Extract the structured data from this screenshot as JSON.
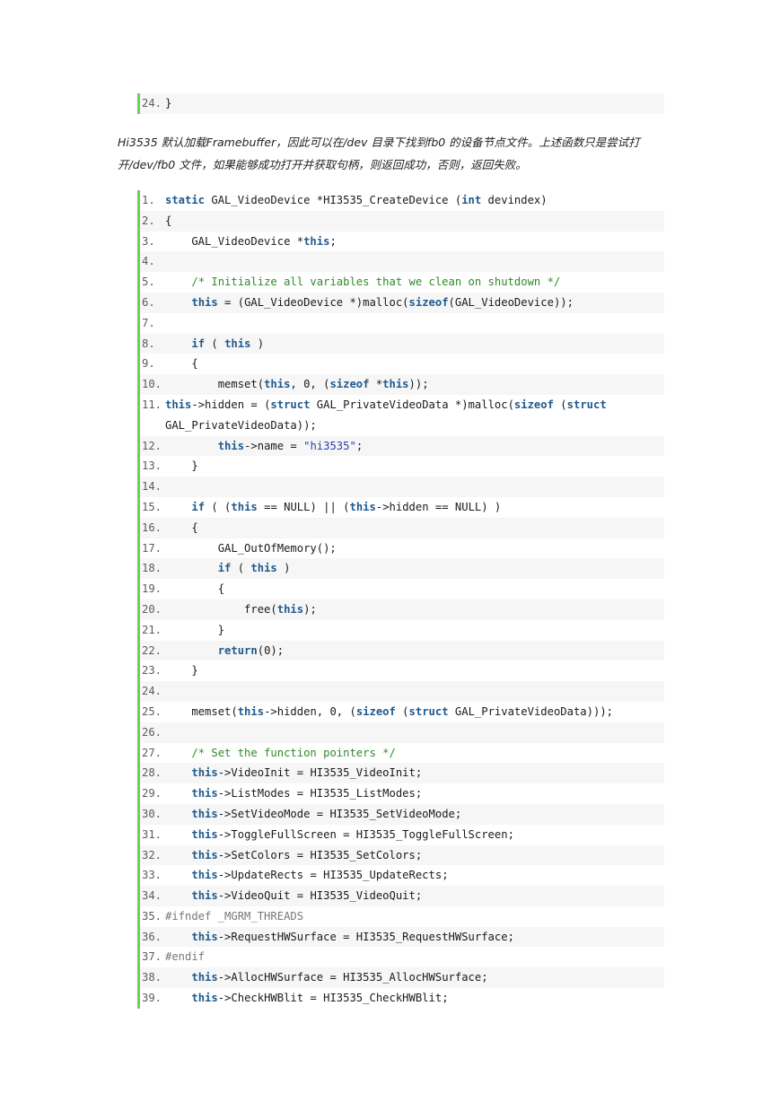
{
  "top_snippet": {
    "lines": [
      {
        "num": "24.",
        "segments": [
          {
            "t": "}",
            "c": ""
          }
        ]
      }
    ]
  },
  "paragraph": "Hi3535 默认加载Framebuffer，因此可以在/dev 目录下找到fb0 的设备节点文件。上述函数只是尝试打开/dev/fb0 文件，如果能够成功打开并获取句柄，则返回成功，否则，返回失败。",
  "code": {
    "lines": [
      {
        "num": "1.",
        "segments": [
          {
            "t": "static",
            "c": "kw"
          },
          {
            "t": " GAL_VideoDevice *HI3535_CreateDevice (",
            "c": ""
          },
          {
            "t": "int",
            "c": "kw"
          },
          {
            "t": " devindex)",
            "c": ""
          }
        ]
      },
      {
        "num": "2.",
        "segments": [
          {
            "t": "{",
            "c": ""
          }
        ]
      },
      {
        "num": "3.",
        "segments": [
          {
            "t": "    GAL_VideoDevice *",
            "c": ""
          },
          {
            "t": "this",
            "c": "kw"
          },
          {
            "t": ";",
            "c": ""
          }
        ]
      },
      {
        "num": "4.",
        "segments": []
      },
      {
        "num": "5.",
        "segments": [
          {
            "t": "    ",
            "c": ""
          },
          {
            "t": "/* Initialize all variables that we clean on shutdown */",
            "c": "cm"
          }
        ]
      },
      {
        "num": "6.",
        "segments": [
          {
            "t": "    ",
            "c": ""
          },
          {
            "t": "this",
            "c": "kw"
          },
          {
            "t": " = (GAL_VideoDevice *)malloc(",
            "c": ""
          },
          {
            "t": "sizeof",
            "c": "kw"
          },
          {
            "t": "(GAL_VideoDevice));",
            "c": ""
          }
        ]
      },
      {
        "num": "7.",
        "segments": []
      },
      {
        "num": "8.",
        "segments": [
          {
            "t": "    ",
            "c": ""
          },
          {
            "t": "if",
            "c": "kw"
          },
          {
            "t": " ( ",
            "c": ""
          },
          {
            "t": "this",
            "c": "kw"
          },
          {
            "t": " )",
            "c": ""
          }
        ]
      },
      {
        "num": "9.",
        "segments": [
          {
            "t": "    {",
            "c": ""
          }
        ]
      },
      {
        "num": "10.",
        "segments": [
          {
            "t": "        memset(",
            "c": ""
          },
          {
            "t": "this",
            "c": "kw"
          },
          {
            "t": ", 0, (",
            "c": ""
          },
          {
            "t": "sizeof",
            "c": "kw"
          },
          {
            "t": " *",
            "c": ""
          },
          {
            "t": "this",
            "c": "kw"
          },
          {
            "t": "));",
            "c": ""
          }
        ]
      },
      {
        "num": "11.",
        "tall": true,
        "segments": [
          {
            "t": "        ",
            "c": ""
          },
          {
            "t": "this",
            "c": "kw"
          },
          {
            "t": "->hidden = (",
            "c": ""
          },
          {
            "t": "struct",
            "c": "kw"
          },
          {
            "t": " GAL_PrivateVideoData *)malloc(",
            "c": ""
          },
          {
            "t": "sizeof",
            "c": "kw"
          },
          {
            "t": " (",
            "c": ""
          },
          {
            "t": "struct",
            "c": "kw"
          },
          {
            "t": " GAL_PrivateVideoData));",
            "c": ""
          }
        ]
      },
      {
        "num": "12.",
        "segments": [
          {
            "t": "        ",
            "c": ""
          },
          {
            "t": "this",
            "c": "kw"
          },
          {
            "t": "->name = ",
            "c": ""
          },
          {
            "t": "\"hi3535\"",
            "c": "st"
          },
          {
            "t": ";",
            "c": ""
          }
        ]
      },
      {
        "num": "13.",
        "segments": [
          {
            "t": "    }",
            "c": ""
          }
        ]
      },
      {
        "num": "14.",
        "segments": []
      },
      {
        "num": "15.",
        "segments": [
          {
            "t": "    ",
            "c": ""
          },
          {
            "t": "if",
            "c": "kw"
          },
          {
            "t": " ( (",
            "c": ""
          },
          {
            "t": "this",
            "c": "kw"
          },
          {
            "t": " == NULL) || (",
            "c": ""
          },
          {
            "t": "this",
            "c": "kw"
          },
          {
            "t": "->hidden == NULL) )",
            "c": ""
          }
        ]
      },
      {
        "num": "16.",
        "segments": [
          {
            "t": "    {",
            "c": ""
          }
        ]
      },
      {
        "num": "17.",
        "segments": [
          {
            "t": "        GAL_OutOfMemory();",
            "c": ""
          }
        ]
      },
      {
        "num": "18.",
        "segments": [
          {
            "t": "        ",
            "c": ""
          },
          {
            "t": "if",
            "c": "kw"
          },
          {
            "t": " ( ",
            "c": ""
          },
          {
            "t": "this",
            "c": "kw"
          },
          {
            "t": " )",
            "c": ""
          }
        ]
      },
      {
        "num": "19.",
        "segments": [
          {
            "t": "        {",
            "c": ""
          }
        ]
      },
      {
        "num": "20.",
        "segments": [
          {
            "t": "            free(",
            "c": ""
          },
          {
            "t": "this",
            "c": "kw"
          },
          {
            "t": ");",
            "c": ""
          }
        ]
      },
      {
        "num": "21.",
        "segments": [
          {
            "t": "        }",
            "c": ""
          }
        ]
      },
      {
        "num": "22.",
        "segments": [
          {
            "t": "        ",
            "c": ""
          },
          {
            "t": "return",
            "c": "kw"
          },
          {
            "t": "(0);",
            "c": ""
          }
        ]
      },
      {
        "num": "23.",
        "segments": [
          {
            "t": "    }",
            "c": ""
          }
        ]
      },
      {
        "num": "24.",
        "segments": []
      },
      {
        "num": "25.",
        "segments": [
          {
            "t": "    memset(",
            "c": ""
          },
          {
            "t": "this",
            "c": "kw"
          },
          {
            "t": "->hidden, 0, (",
            "c": ""
          },
          {
            "t": "sizeof",
            "c": "kw"
          },
          {
            "t": " (",
            "c": ""
          },
          {
            "t": "struct",
            "c": "kw"
          },
          {
            "t": " GAL_PrivateVideoData)));",
            "c": ""
          }
        ]
      },
      {
        "num": "26.",
        "segments": []
      },
      {
        "num": "27.",
        "segments": [
          {
            "t": "    ",
            "c": ""
          },
          {
            "t": "/* Set the function pointers */",
            "c": "cm"
          }
        ]
      },
      {
        "num": "28.",
        "segments": [
          {
            "t": "    ",
            "c": ""
          },
          {
            "t": "this",
            "c": "kw"
          },
          {
            "t": "->VideoInit = HI3535_VideoInit;",
            "c": ""
          }
        ]
      },
      {
        "num": "29.",
        "segments": [
          {
            "t": "    ",
            "c": ""
          },
          {
            "t": "this",
            "c": "kw"
          },
          {
            "t": "->ListModes = HI3535_ListModes;",
            "c": ""
          }
        ]
      },
      {
        "num": "30.",
        "segments": [
          {
            "t": "    ",
            "c": ""
          },
          {
            "t": "this",
            "c": "kw"
          },
          {
            "t": "->SetVideoMode = HI3535_SetVideoMode;",
            "c": ""
          }
        ]
      },
      {
        "num": "31.",
        "segments": [
          {
            "t": "    ",
            "c": ""
          },
          {
            "t": "this",
            "c": "kw"
          },
          {
            "t": "->ToggleFullScreen = HI3535_ToggleFullScreen;",
            "c": ""
          }
        ]
      },
      {
        "num": "32.",
        "segments": [
          {
            "t": "    ",
            "c": ""
          },
          {
            "t": "this",
            "c": "kw"
          },
          {
            "t": "->SetColors = HI3535_SetColors;",
            "c": ""
          }
        ]
      },
      {
        "num": "33.",
        "segments": [
          {
            "t": "    ",
            "c": ""
          },
          {
            "t": "this",
            "c": "kw"
          },
          {
            "t": "->UpdateRects = HI3535_UpdateRects;",
            "c": ""
          }
        ]
      },
      {
        "num": "34.",
        "segments": [
          {
            "t": "    ",
            "c": ""
          },
          {
            "t": "this",
            "c": "kw"
          },
          {
            "t": "->VideoQuit = HI3535_VideoQuit;",
            "c": ""
          }
        ]
      },
      {
        "num": "35.",
        "segments": [
          {
            "t": "#ifndef _MGRM_THREADS",
            "c": "pp"
          }
        ]
      },
      {
        "num": "36.",
        "segments": [
          {
            "t": "    ",
            "c": ""
          },
          {
            "t": "this",
            "c": "kw"
          },
          {
            "t": "->RequestHWSurface = HI3535_RequestHWSurface;",
            "c": ""
          }
        ]
      },
      {
        "num": "37.",
        "segments": [
          {
            "t": "#endif",
            "c": "pp"
          }
        ]
      },
      {
        "num": "38.",
        "segments": [
          {
            "t": "    ",
            "c": ""
          },
          {
            "t": "this",
            "c": "kw"
          },
          {
            "t": "->AllocHWSurface = HI3535_AllocHWSurface;",
            "c": ""
          }
        ]
      },
      {
        "num": "39.",
        "segments": [
          {
            "t": "    ",
            "c": ""
          },
          {
            "t": "this",
            "c": "kw"
          },
          {
            "t": "->CheckHWBlit = HI3535_CheckHWBlit;",
            "c": ""
          }
        ]
      }
    ]
  },
  "colors": {
    "gutter_bar": "#6ccf5a",
    "keyword": "#1f5a8f",
    "comment": "#2f8a2a",
    "string": "#2a3fa8",
    "preprocessor": "#777777",
    "alt_row": "#f6f6f6"
  }
}
